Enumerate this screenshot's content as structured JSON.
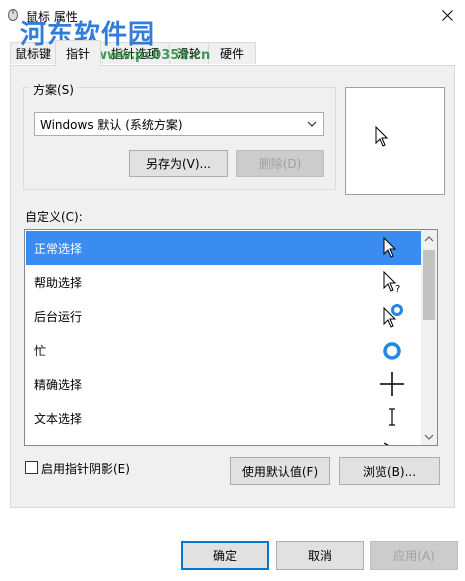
{
  "window": {
    "title": "鼠标 属性",
    "watermark": "河东软件园",
    "watermark_url": "www.pc0359.cn"
  },
  "tabs": [
    {
      "label": "鼠标键"
    },
    {
      "label": "指针"
    },
    {
      "label": "指针选项"
    },
    {
      "label": "滑轮"
    },
    {
      "label": "硬件"
    }
  ],
  "scheme": {
    "group_label": "方案(S)",
    "selected": "Windows 默认 (系统方案)",
    "save_as_label": "另存为(V)...",
    "delete_label": "删除(D)"
  },
  "custom": {
    "label": "自定义(C):",
    "items": [
      {
        "label": "正常选择",
        "icon": "arrow-cursor-icon"
      },
      {
        "label": "帮助选择",
        "icon": "help-cursor-icon"
      },
      {
        "label": "后台运行",
        "icon": "working-in-background-cursor-icon"
      },
      {
        "label": "忙",
        "icon": "busy-cursor-icon"
      },
      {
        "label": "精确选择",
        "icon": "crosshair-cursor-icon"
      },
      {
        "label": "文本选择",
        "icon": "text-cursor-icon"
      },
      {
        "label": "",
        "icon": "handwriting-cursor-icon"
      }
    ]
  },
  "shadow": {
    "label": "启用指针阴影(E)",
    "checked": false
  },
  "buttons": {
    "use_default": "使用默认值(F)",
    "browse": "浏览(B)...",
    "ok": "确定",
    "cancel": "取消",
    "apply": "应用(A)"
  },
  "colors": {
    "selection": "#3b8cf0",
    "accent": "#0078d7"
  }
}
